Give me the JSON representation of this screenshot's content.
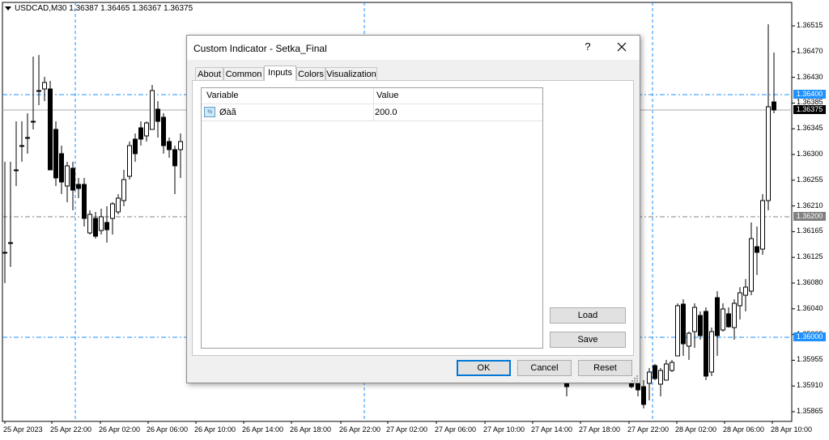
{
  "chart": {
    "symbol_header": "USDCAD,M30  1.36387 1.36465 1.36367 1.36375",
    "price_axis": [
      "1.36515",
      "1.36470",
      "1.36430",
      "1.36385",
      "1.36345",
      "1.36300",
      "1.36255",
      "1.36210",
      "1.36165",
      "1.36125",
      "1.36080",
      "1.36040",
      "1.35995",
      "1.35955",
      "1.35910",
      "1.35865"
    ],
    "price_tags": {
      "level_high": "1.36400",
      "current": "1.36375",
      "level_mid": "1.36200",
      "level_low": "1.36000"
    },
    "time_axis": [
      "25 Apr 2023",
      "25 Apr 22:00",
      "26 Apr 02:00",
      "26 Apr 06:00",
      "26 Apr 10:00",
      "26 Apr 14:00",
      "26 Apr 18:00",
      "26 Apr 22:00",
      "27 Apr 02:00",
      "27 Apr 06:00",
      "27 Apr 10:00",
      "27 Apr 14:00",
      "27 Apr 18:00",
      "27 Apr 22:00",
      "28 Apr 02:00",
      "28 Apr 06:00",
      "28 Apr 10:00"
    ],
    "colors": {
      "level_line": "#1e90ff",
      "current_tag": "#000000",
      "mid_tag": "#808080",
      "level_tag": "#1e90ff"
    }
  },
  "dialog": {
    "title": "Custom Indicator - Setka_Final",
    "help_label": "?",
    "tabs": [
      "About",
      "Common",
      "Inputs",
      "Colors",
      "Visualization"
    ],
    "active_tab": "Inputs",
    "inputs_table": {
      "columns": [
        "Variable",
        "Value"
      ],
      "rows": [
        {
          "icon": "parameter-icon",
          "icon_text": "½",
          "variable": "Øàã",
          "value": "200.0"
        }
      ]
    },
    "load_label": "Load",
    "save_label": "Save",
    "ok_label": "OK",
    "cancel_label": "Cancel",
    "reset_label": "Reset"
  }
}
